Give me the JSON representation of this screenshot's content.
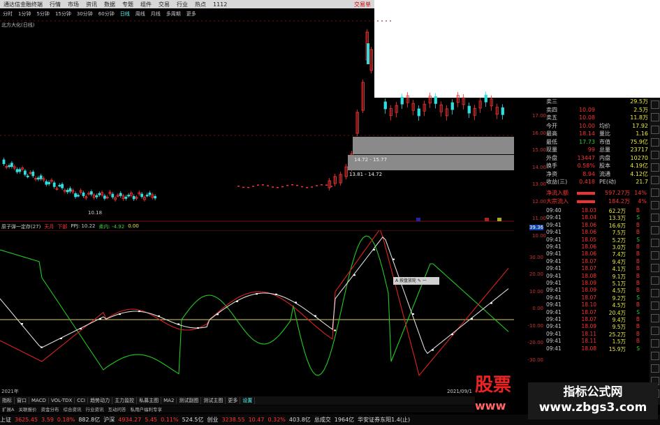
{
  "topbar": {
    "items": [
      "通达信金融终端",
      "行情",
      "市场",
      "资讯",
      "数据",
      "专题",
      "组件",
      "交易",
      "行业",
      "热点",
      "1112"
    ],
    "brand": "交易单"
  },
  "period_bar": {
    "items": [
      "分时",
      "1分钟",
      "5分钟",
      "15分钟",
      "30分钟",
      "60分钟",
      "日线",
      "周线",
      "月线",
      "多周期",
      "更多"
    ],
    "active_index": 6
  },
  "stock": {
    "name": "北方大化(日线)"
  },
  "main_chart": {
    "annotations": [
      "10.18",
      "13.81 - 14.72",
      "14.72 - 15.77"
    ],
    "colors": {
      "up": "#ff3333",
      "down": "#33dddd"
    }
  },
  "indicator": {
    "title": "原子弹一定存(27)",
    "labels": [
      {
        "text": "天月",
        "color": "#ff3333"
      },
      {
        "text": "下部",
        "color": "#ff3333"
      },
      {
        "text": "PPJ: 10.22",
        "color": "#cccccc"
      },
      {
        "text": "柔内: -4.92",
        "color": "#33cc33"
      },
      {
        "text": "0.00",
        "color": "#eeee33"
      }
    ],
    "axis_labels": [
      "39.36",
      "30.00",
      "20.00",
      "10.00",
      "0.00",
      "-10.00",
      "-20.00",
      "-30.00"
    ],
    "date_label": "2021/09/1",
    "left_date": "2021年",
    "tooltip": "A 按盘放轮 ✎ 一"
  },
  "price_axis": [
    "17.00",
    "16.00",
    "15.00",
    "14.00",
    "13.00",
    "12.00",
    "11.00",
    "10.00"
  ],
  "quote_panel": {
    "rows": [
      {
        "l": "卖三",
        "v1": "",
        "l2": "",
        "v2": "29.5万"
      },
      {
        "l": "卖四",
        "v1": "10.09",
        "l2": "",
        "v2": "2.5万"
      },
      {
        "l": "卖五",
        "v1": "10.08",
        "l2": "",
        "v2": "11.8万"
      },
      {
        "l": "今开",
        "v1": "10.00",
        "l2": "均价",
        "v2": "17.92"
      },
      {
        "l": "最高",
        "v1": "18.14",
        "l2": "量比",
        "v2": "1.16"
      },
      {
        "l": "最低",
        "v1": "17.73",
        "l2": "市值",
        "v2": "75.9亿"
      },
      {
        "l": "现量",
        "v1": "99",
        "l2": "总量",
        "v2": "23717"
      },
      {
        "l": "外盘",
        "v1": "13447",
        "l2": "内盘",
        "v2": "10270"
      },
      {
        "l": "换手",
        "v1": "0.58%",
        "l2": "股本",
        "v2": "4.19亿"
      },
      {
        "l": "净资",
        "v1": "8.94",
        "l2": "流通",
        "v2": "4.12亿"
      },
      {
        "l": "收益(三)",
        "v1": "0.418",
        "l2": "PE(动)",
        "v2": "21.7"
      }
    ],
    "flows": [
      {
        "label": "净流入额",
        "value": "597.27万",
        "pct": "14%"
      },
      {
        "label": "大宗流入",
        "value": "184.2万",
        "pct": "4%"
      }
    ],
    "ticks": [
      {
        "t": "09:40",
        "p": "18.03",
        "v": "62.2万",
        "bs": "B"
      },
      {
        "t": "09:41",
        "p": "18.04",
        "v": "13.3万",
        "bs": "S"
      },
      {
        "t": "09:41",
        "p": "18.06",
        "v": "16.6万",
        "bs": "B"
      },
      {
        "t": "09:41",
        "p": "18.06",
        "v": "7.5万",
        "bs": "B"
      },
      {
        "t": "09:41",
        "p": "18.05",
        "v": "5.2万",
        "bs": "S"
      },
      {
        "t": "09:41",
        "p": "18.06",
        "v": "3.0万",
        "bs": "B"
      },
      {
        "t": "09:41",
        "p": "18.06",
        "v": "7.4万",
        "bs": "B"
      },
      {
        "t": "09:41",
        "p": "18.07",
        "v": "9.4万",
        "bs": "B"
      },
      {
        "t": "09:41",
        "p": "18.07",
        "v": "4.1万",
        "bs": "B"
      },
      {
        "t": "09:41",
        "p": "18.08",
        "v": "9.1万",
        "bs": "B"
      },
      {
        "t": "09:41",
        "p": "18.09",
        "v": "5.1万",
        "bs": "B"
      },
      {
        "t": "09:41",
        "p": "18.09",
        "v": "4.5万",
        "bs": "B"
      },
      {
        "t": "09:41",
        "p": "18.07",
        "v": "9.2万",
        "bs": "S"
      },
      {
        "t": "09:41",
        "p": "18.10",
        "v": "4.5万",
        "bs": "B"
      },
      {
        "t": "09:41",
        "p": "18.07",
        "v": "20.4万",
        "bs": "S"
      },
      {
        "t": "09:41",
        "p": "18.07",
        "v": "9.4万",
        "bs": "B"
      },
      {
        "t": "09:41",
        "p": "18.09",
        "v": "9.5万",
        "bs": "B"
      },
      {
        "t": "09:41",
        "p": "18.11",
        "v": "25.2万",
        "bs": "B"
      },
      {
        "t": "09:41",
        "p": "18.11",
        "v": "1.5万",
        "bs": "B"
      },
      {
        "t": "09:41",
        "p": "18.08",
        "v": "15.9万",
        "bs": "S"
      }
    ]
  },
  "tabbar": {
    "items": [
      "指标",
      "窗口",
      "MACD",
      "VOL-TDX",
      "CCI",
      "趋势动力",
      "主力监控",
      "私募主图",
      "MA2",
      "测试副图",
      "测试主图",
      "更多",
      "设置"
    ]
  },
  "tabbar2": {
    "items": [
      "扩展A",
      "关联报价",
      "资金分布",
      "综合资讯",
      "行业资讯",
      "互动问答",
      "私用户福利专享"
    ]
  },
  "statusbar": {
    "items": [
      {
        "text": "上证",
        "c": "w"
      },
      {
        "text": "3625.45",
        "c": "r"
      },
      {
        "text": "3.59",
        "c": "r"
      },
      {
        "text": "0.18%",
        "c": "r"
      },
      {
        "text": "882.8亿",
        "c": "w"
      },
      {
        "text": "沪深",
        "c": "w"
      },
      {
        "text": "4934.27",
        "c": "r"
      },
      {
        "text": "5.45",
        "c": "r"
      },
      {
        "text": "0.11%",
        "c": "r"
      },
      {
        "text": "524.5亿",
        "c": "w"
      },
      {
        "text": "创业",
        "c": "w"
      },
      {
        "text": "3238.55",
        "c": "r"
      },
      {
        "text": "10.47",
        "c": "r"
      },
      {
        "text": "0.32%",
        "c": "r"
      },
      {
        "text": "403.8亿",
        "c": "w"
      },
      {
        "text": "总成交",
        "c": "w"
      },
      {
        "text": "1964亿",
        "c": "w"
      },
      {
        "text": "华安证券东阳1.4(止)",
        "c": "w"
      }
    ]
  },
  "watermark": {
    "left_top": "股票",
    "left_bottom": "www",
    "right_title": "指标公式网",
    "right_url": "www.zbgs3.com"
  }
}
